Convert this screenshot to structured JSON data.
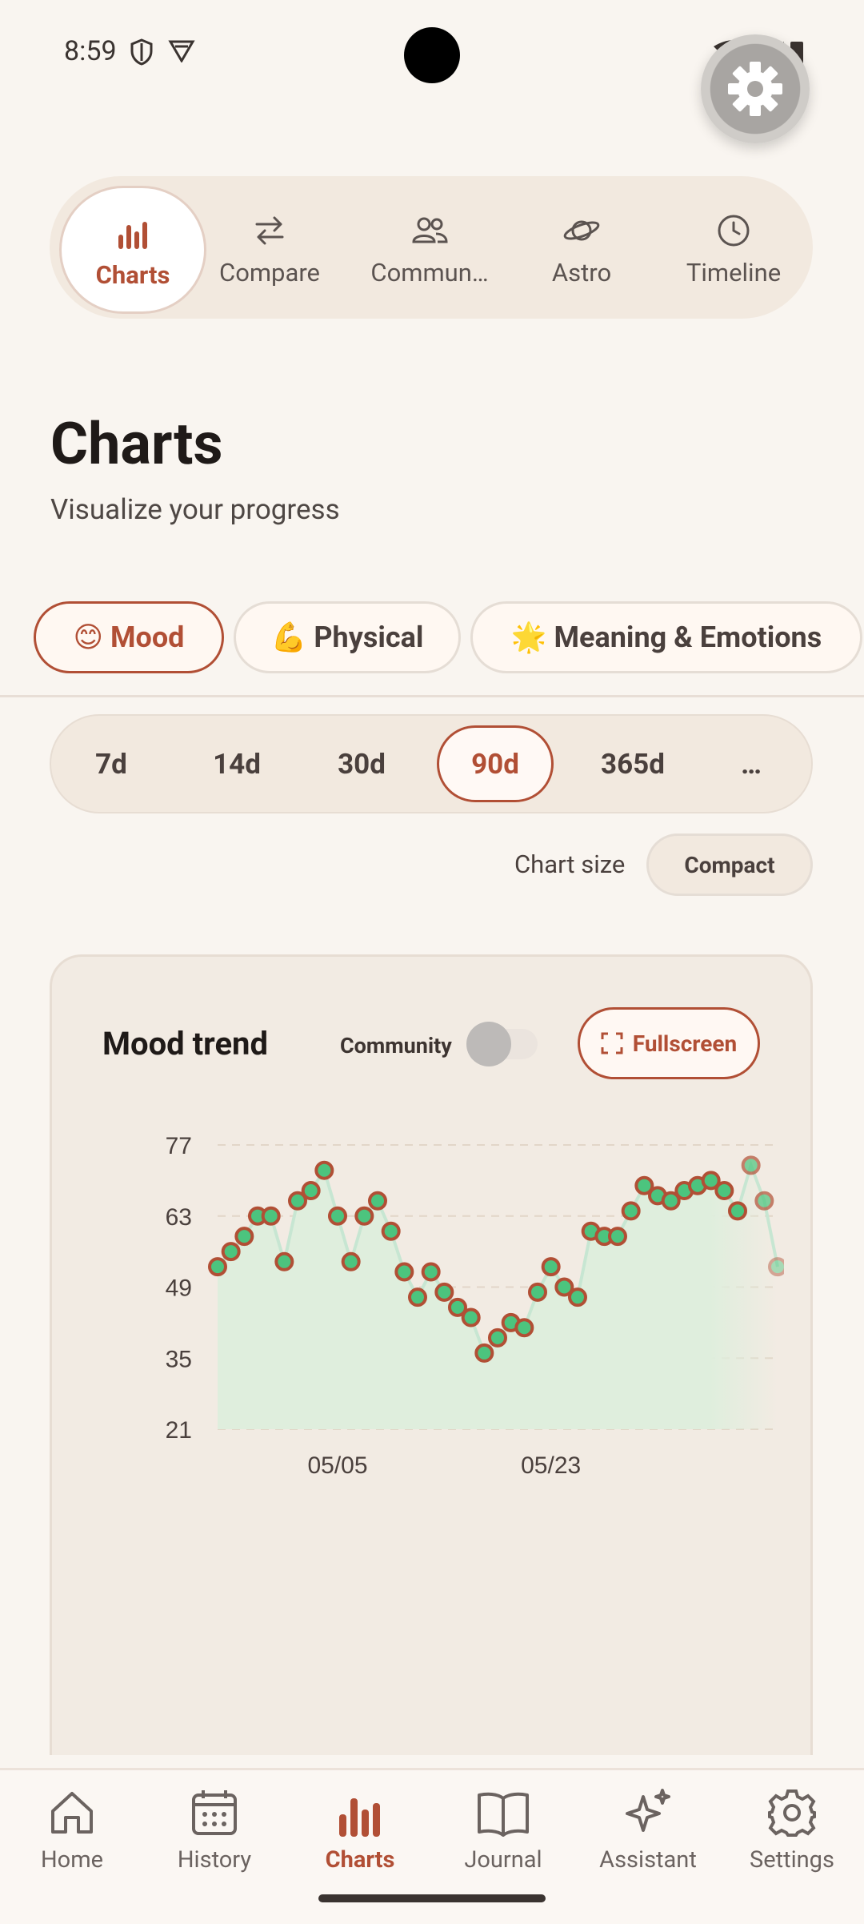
{
  "status": {
    "time": "8:59"
  },
  "top_tabs": [
    {
      "label": "Charts",
      "icon": "bar-chart-icon",
      "active": true
    },
    {
      "label": "Compare",
      "icon": "swap-arrows-icon"
    },
    {
      "label": "Commun…",
      "icon": "people-icon"
    },
    {
      "label": "Astro",
      "icon": "planet-icon"
    },
    {
      "label": "Timeline",
      "icon": "clock-icon"
    }
  ],
  "page": {
    "title": "Charts",
    "subtitle": "Visualize your progress"
  },
  "categories": [
    {
      "label": "😊 Mood",
      "active": true
    },
    {
      "label": "💪 Physical"
    },
    {
      "label": "🌟 Meaning & Emotions"
    }
  ],
  "ranges": [
    {
      "label": "7d"
    },
    {
      "label": "14d"
    },
    {
      "label": "30d"
    },
    {
      "label": "90d",
      "active": true
    },
    {
      "label": "365d"
    },
    {
      "label": "…"
    }
  ],
  "chart_size": {
    "label": "Chart size",
    "value": "Compact"
  },
  "chart_card": {
    "title": "Mood trend",
    "community_label": "Community",
    "community_enabled": false,
    "fullscreen_label": "Fullscreen"
  },
  "colors": {
    "accent": "#b14f35",
    "point_fill": "#4cc47e",
    "area": "#dfeedd"
  },
  "chart_data": {
    "type": "area",
    "ylim": [
      21,
      77
    ],
    "yticks": [
      "77",
      "63",
      "49",
      "35",
      "21"
    ],
    "xtick_labels": [
      "05/05",
      "05/23"
    ],
    "values": [
      53,
      56,
      59,
      63,
      63,
      54,
      66,
      68,
      72,
      63,
      54,
      63,
      66,
      60,
      52,
      47,
      52,
      48,
      45,
      43,
      36,
      39,
      42,
      41,
      48,
      53,
      49,
      47,
      60,
      59,
      59,
      64,
      69,
      67,
      66,
      68,
      69,
      70,
      68,
      64,
      73,
      66,
      53
    ]
  },
  "bottom_nav": [
    {
      "label": "Home",
      "icon": "home-icon"
    },
    {
      "label": "History",
      "icon": "calendar-icon"
    },
    {
      "label": "Charts",
      "icon": "bar-chart-icon",
      "active": true
    },
    {
      "label": "Journal",
      "icon": "book-icon"
    },
    {
      "label": "Assistant",
      "icon": "sparkles-icon"
    },
    {
      "label": "Settings",
      "icon": "gear-icon"
    }
  ]
}
